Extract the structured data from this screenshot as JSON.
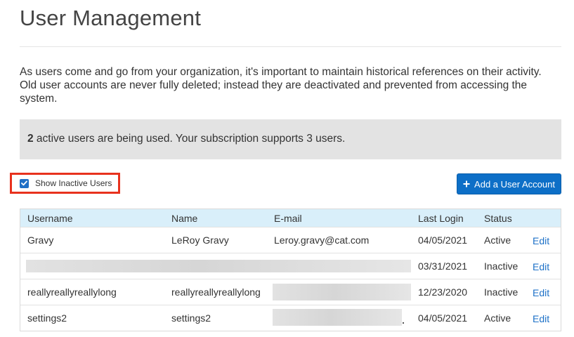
{
  "page": {
    "title": "User Management",
    "intro": "As users come and go from your organization, it's important to maintain historical references on their activity. Old user accounts are never fully deleted; instead they are deactivated and prevented from accessing the system."
  },
  "subscription": {
    "active_count": "2",
    "message": " active users are being used. Your subscription supports 3 users."
  },
  "controls": {
    "show_inactive_label": "Show Inactive Users",
    "show_inactive_checked": true,
    "add_user_label": "Add a User Account",
    "accent_color": "#0d6fc7",
    "highlight_color": "#e8321e"
  },
  "table": {
    "headers": {
      "username": "Username",
      "name": "Name",
      "email": "E-mail",
      "last_login": "Last Login",
      "status": "Status"
    },
    "rows": [
      {
        "username": "Gravy",
        "name": "LeRoy Gravy",
        "email": "Leroy.gravy@cat.com",
        "last_login": "04/05/2021",
        "status": "Active",
        "edit": "Edit"
      },
      {
        "username": "",
        "name": "",
        "email": "",
        "last_login": "03/31/2021",
        "status": "Inactive",
        "edit": "Edit"
      },
      {
        "username": "reallyreallyreallylong",
        "name": "reallyreallyreallylong",
        "email": "",
        "last_login": "12/23/2020",
        "status": "Inactive",
        "edit": "Edit"
      },
      {
        "username": "settings2",
        "name": "settings2",
        "email": "",
        "last_login": "04/05/2021",
        "status": "Active",
        "edit": "Edit"
      }
    ]
  },
  "icons": {
    "checkbox": "check-icon",
    "add_button": "plus-icon"
  }
}
